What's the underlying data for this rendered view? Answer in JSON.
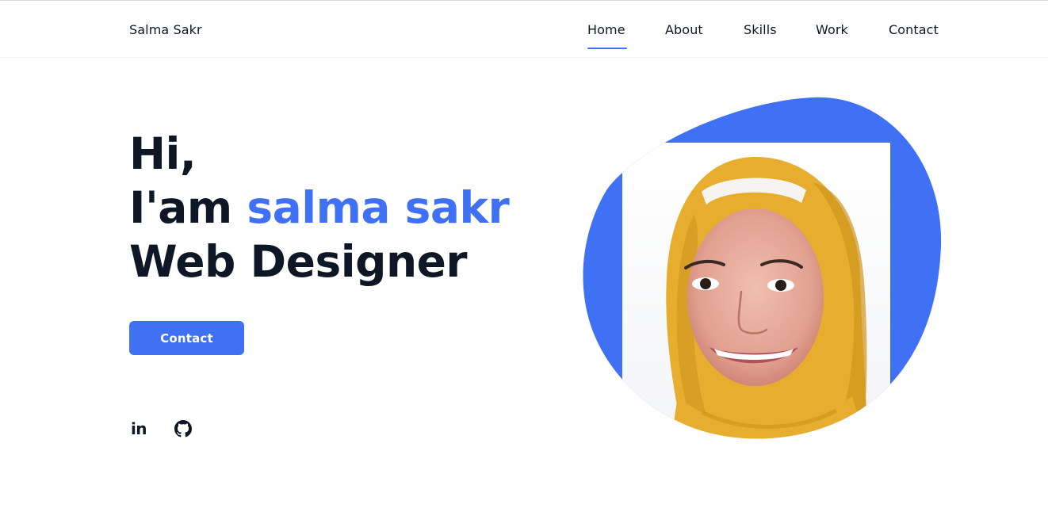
{
  "header": {
    "logo": "Salma Sakr",
    "nav": {
      "home": "Home",
      "about": "About",
      "skills": "Skills",
      "work": "Work",
      "contact": "Contact"
    },
    "active_item": "Home"
  },
  "hero": {
    "greeting": "Hi,",
    "intro_prefix": "I'am ",
    "name": "salma sakr",
    "role": "Web Designer",
    "contact_button": "Contact"
  },
  "social": {
    "linkedin": "in",
    "icons": [
      "linkedin-icon",
      "github-icon"
    ]
  },
  "colors": {
    "accent": "#4070f4",
    "text": "#0e1726",
    "background": "#ffffff",
    "hijab": "#e6ad2e"
  }
}
